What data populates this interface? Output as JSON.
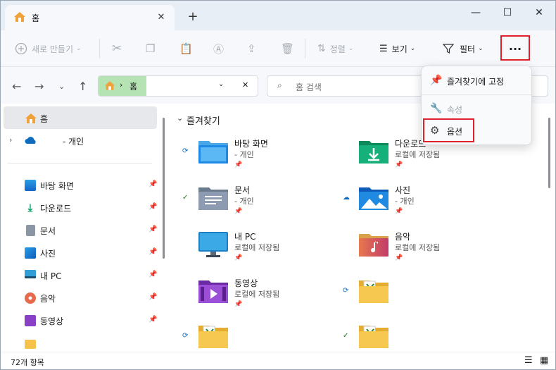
{
  "window": {
    "tab_title": "홈",
    "new_tab": "+",
    "close_tab": "✕"
  },
  "controls": {
    "minimize": "—",
    "maximize": "☐",
    "close": "✕"
  },
  "toolbar": {
    "new_label": "새로 만들기",
    "sort_label": "정렬",
    "view_label": "보기",
    "filter_label": "필터",
    "more_label": "···"
  },
  "address": {
    "path": "홈",
    "search_placeholder": "홈 검색"
  },
  "sidebar": {
    "home": "홈",
    "onedrive": "- 개인",
    "items": [
      {
        "label": "바탕 화면",
        "icon": "desktop-icon"
      },
      {
        "label": "다운로드",
        "icon": "download-icon"
      },
      {
        "label": "문서",
        "icon": "document-icon"
      },
      {
        "label": "사진",
        "icon": "pictures-icon"
      },
      {
        "label": "내 PC",
        "icon": "pc-icon"
      },
      {
        "label": "음악",
        "icon": "music-icon"
      },
      {
        "label": "동영상",
        "icon": "video-icon"
      }
    ]
  },
  "main": {
    "section": "즐겨찾기",
    "tiles": [
      {
        "name": "바탕 화면",
        "sub": "- 개인"
      },
      {
        "name": "다운로드",
        "sub": "로컬에 저장됨"
      },
      {
        "name": "문서",
        "sub": "- 개인"
      },
      {
        "name": "사진",
        "sub": "- 개인"
      },
      {
        "name": "내 PC",
        "sub": "로컬에 저장됨"
      },
      {
        "name": "음악",
        "sub": "로컬에 저장됨"
      },
      {
        "name": "동영상",
        "sub": "로컬에 저장됨"
      }
    ]
  },
  "menu": {
    "pin": "즐겨찾기에 고정",
    "properties": "속성",
    "options": "옵션"
  },
  "status": {
    "count": "72개 항목"
  },
  "colors": {
    "highlight": "#e0202b",
    "accent": "#0067c0"
  }
}
